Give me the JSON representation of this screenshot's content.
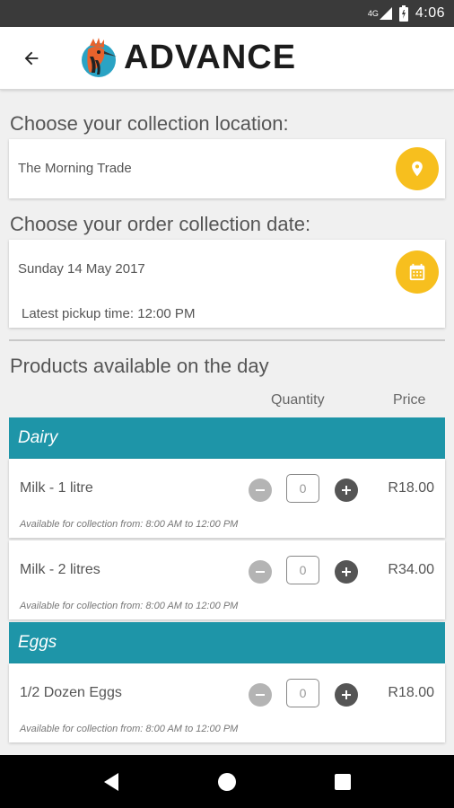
{
  "status_bar": {
    "network": "4G",
    "time": "4:06"
  },
  "header": {
    "back_icon": "arrow-left-icon",
    "logo_text": "ADVANCE"
  },
  "location": {
    "title": "Choose your collection location:",
    "value": "The Morning Trade",
    "button_icon": "location-pin-icon"
  },
  "date": {
    "title": "Choose your order collection date:",
    "value": "Sunday 14 May 2017",
    "pickup": "Latest pickup time: 12:00 PM",
    "button_icon": "calendar-icon"
  },
  "products": {
    "title": "Products available on the day",
    "col_quantity": "Quantity",
    "col_price": "Price",
    "categories": [
      {
        "name": "Dairy",
        "items": [
          {
            "name": "Milk - 1 litre",
            "qty": "0",
            "price": "R18.00",
            "availability": "Available for collection from: 8:00 AM to 12:00 PM"
          },
          {
            "name": "Milk - 2 litres",
            "qty": "0",
            "price": "R34.00",
            "availability": "Available for collection from: 8:00 AM to 12:00 PM"
          }
        ]
      },
      {
        "name": "Eggs",
        "items": [
          {
            "name": "1/2 Dozen Eggs",
            "qty": "0",
            "price": "R18.00",
            "availability": "Available for collection from: 8:00 AM to 12:00 PM"
          }
        ]
      }
    ]
  },
  "colors": {
    "accent_yellow": "#f7bf1e",
    "category_teal": "#1e95a8"
  }
}
